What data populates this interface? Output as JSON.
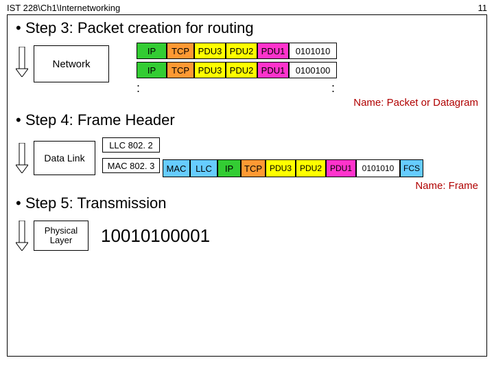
{
  "header": {
    "path": "IST 228\\Ch1\\Internetworking",
    "page": "11"
  },
  "step3": {
    "title": "Step 3: Packet creation  for routing",
    "layer": "Network",
    "ip": "IP",
    "tcp": "TCP",
    "pdu3": "PDU3",
    "pdu2": "PDU2",
    "pdu1": "PDU1",
    "bits_a": "0101010",
    "bits_b": "0100100",
    "dots": ":",
    "name": "Name: Packet or Datagram"
  },
  "step4": {
    "title": "Step 4: Frame Header",
    "layer": "Data Link",
    "llc": "LLC 802. 2",
    "mac": "MAC 802. 3",
    "fMac": "MAC",
    "fLlc": "LLC",
    "ip": "IP",
    "tcp": "TCP",
    "pdu3": "PDU3",
    "pdu2": "PDU2",
    "pdu1": "PDU1",
    "bits": "0101010",
    "fcs": "FCS",
    "name": "Name: Frame"
  },
  "step5": {
    "title": "Step 5: Transmission",
    "layer": "Physical\nLayer",
    "bits": "10010100001"
  }
}
